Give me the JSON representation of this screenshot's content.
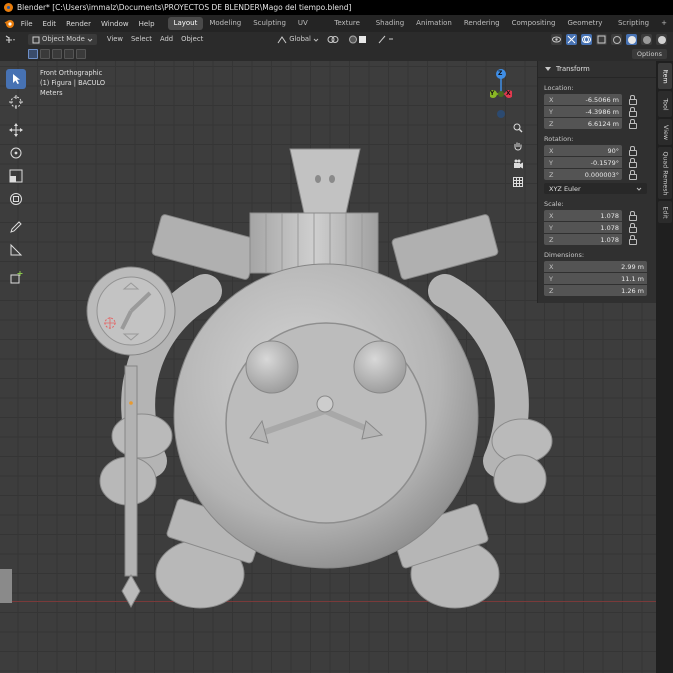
{
  "window": {
    "title": "Blender* [C:\\Users\\immalz\\Documents\\PROYECTOS DE BLENDER\\Mago del tiempo.blend]"
  },
  "menu": {
    "items": [
      "File",
      "Edit",
      "Render",
      "Window",
      "Help"
    ]
  },
  "workspaces": {
    "tabs": [
      "Layout",
      "Modeling",
      "Sculpting",
      "UV Editing",
      "Texture Paint",
      "Shading",
      "Animation",
      "Rendering",
      "Compositing",
      "Geometry Nodes",
      "Scripting"
    ],
    "active": "Layout",
    "add_label": "+"
  },
  "header": {
    "mode": "Object Mode",
    "view": "View",
    "select": "Select",
    "add": "Add",
    "object": "Object",
    "orientation": "Global",
    "options": "Options"
  },
  "viewport": {
    "view_name": "Front Orthographic",
    "collection": "(1) Figura | BACULO",
    "units": "Meters"
  },
  "gizmo": {
    "z": "Z",
    "y": "Y",
    "x": "X"
  },
  "npanel": {
    "section": "Transform",
    "location_label": "Location:",
    "location": [
      {
        "axis": "X",
        "value": "-6.5066 m"
      },
      {
        "axis": "Y",
        "value": "-4.3986 m"
      },
      {
        "axis": "Z",
        "value": "6.6124 m"
      }
    ],
    "rotation_label": "Rotation:",
    "rotation": [
      {
        "axis": "X",
        "value": "90°"
      },
      {
        "axis": "Y",
        "value": "-0.1579°"
      },
      {
        "axis": "Z",
        "value": "0.000003°"
      }
    ],
    "rotation_mode": "XYZ Euler",
    "scale_label": "Scale:",
    "scale": [
      {
        "axis": "X",
        "value": "1.078"
      },
      {
        "axis": "Y",
        "value": "1.078"
      },
      {
        "axis": "Z",
        "value": "1.078"
      }
    ],
    "dimensions_label": "Dimensions:",
    "dimensions": [
      {
        "axis": "X",
        "value": "2.99 m"
      },
      {
        "axis": "Y",
        "value": "11.1 m"
      },
      {
        "axis": "Z",
        "value": "1.26 m"
      }
    ]
  },
  "sidetabs": [
    "Item",
    "Tool",
    "View",
    "Quad Remesh",
    "Edit"
  ],
  "colors": {
    "accent": "#4772b3",
    "axis_x": "#e2394e",
    "axis_y": "#8ab825",
    "axis_z": "#3f8ee6",
    "viewport_bg": "#3d3d3d",
    "model": "#bdbdbd"
  }
}
